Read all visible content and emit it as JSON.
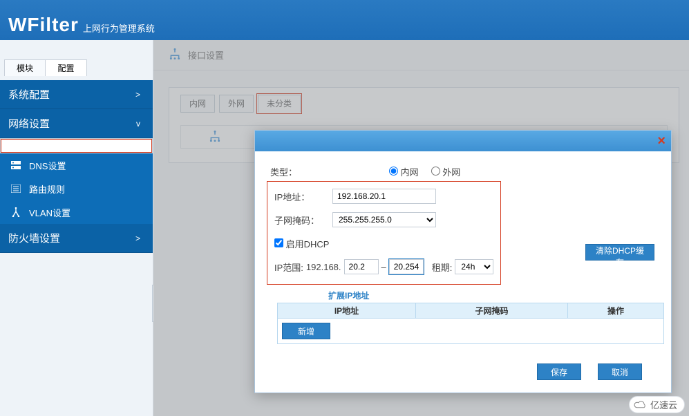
{
  "brand": {
    "name": "WFilter",
    "sub": "上网行为管理系统"
  },
  "sidebar": {
    "tabs": [
      "模块",
      "配置"
    ],
    "groups": [
      {
        "label": "系统配置",
        "open": false,
        "chev": ">"
      },
      {
        "label": "网络设置",
        "open": true,
        "chev": "v",
        "items": [
          {
            "icon": "iface",
            "label": "接口设置",
            "sel": true
          },
          {
            "icon": "disk",
            "label": "DNS设置"
          },
          {
            "icon": "list",
            "label": "路由规则"
          },
          {
            "icon": "fork",
            "label": "VLAN设置"
          }
        ]
      },
      {
        "label": "防火墙设置",
        "open": false,
        "chev": ">"
      }
    ]
  },
  "breadcrumb": {
    "title": "接口设置"
  },
  "panel": {
    "tabs": [
      "内网",
      "外网",
      "未分类"
    ],
    "active": 2
  },
  "dialog": {
    "type_label": "类型：",
    "type_opts": [
      "内网",
      "外网"
    ],
    "type_sel": 0,
    "ip_label": "IP地址：",
    "ip_value": "192.168.20.1",
    "mask_label": "子网掩码：",
    "mask_value": "255.255.255.0",
    "dhcp_label": "启用DHCP",
    "dhcp_on": true,
    "range_label": "IP范围:",
    "range_prefix": "192.168.",
    "range_from": "20.2",
    "range_to": "20.254",
    "lease_label": "租期:",
    "lease_value": "24h",
    "clear_btn": "清除DHCP缓存",
    "ext_title": "扩展IP地址",
    "ext_cols": [
      "IP地址",
      "子网掩码",
      "操作"
    ],
    "add_btn": "新增",
    "save_btn": "保存",
    "cancel_btn": "取消"
  },
  "watermark": "亿速云"
}
